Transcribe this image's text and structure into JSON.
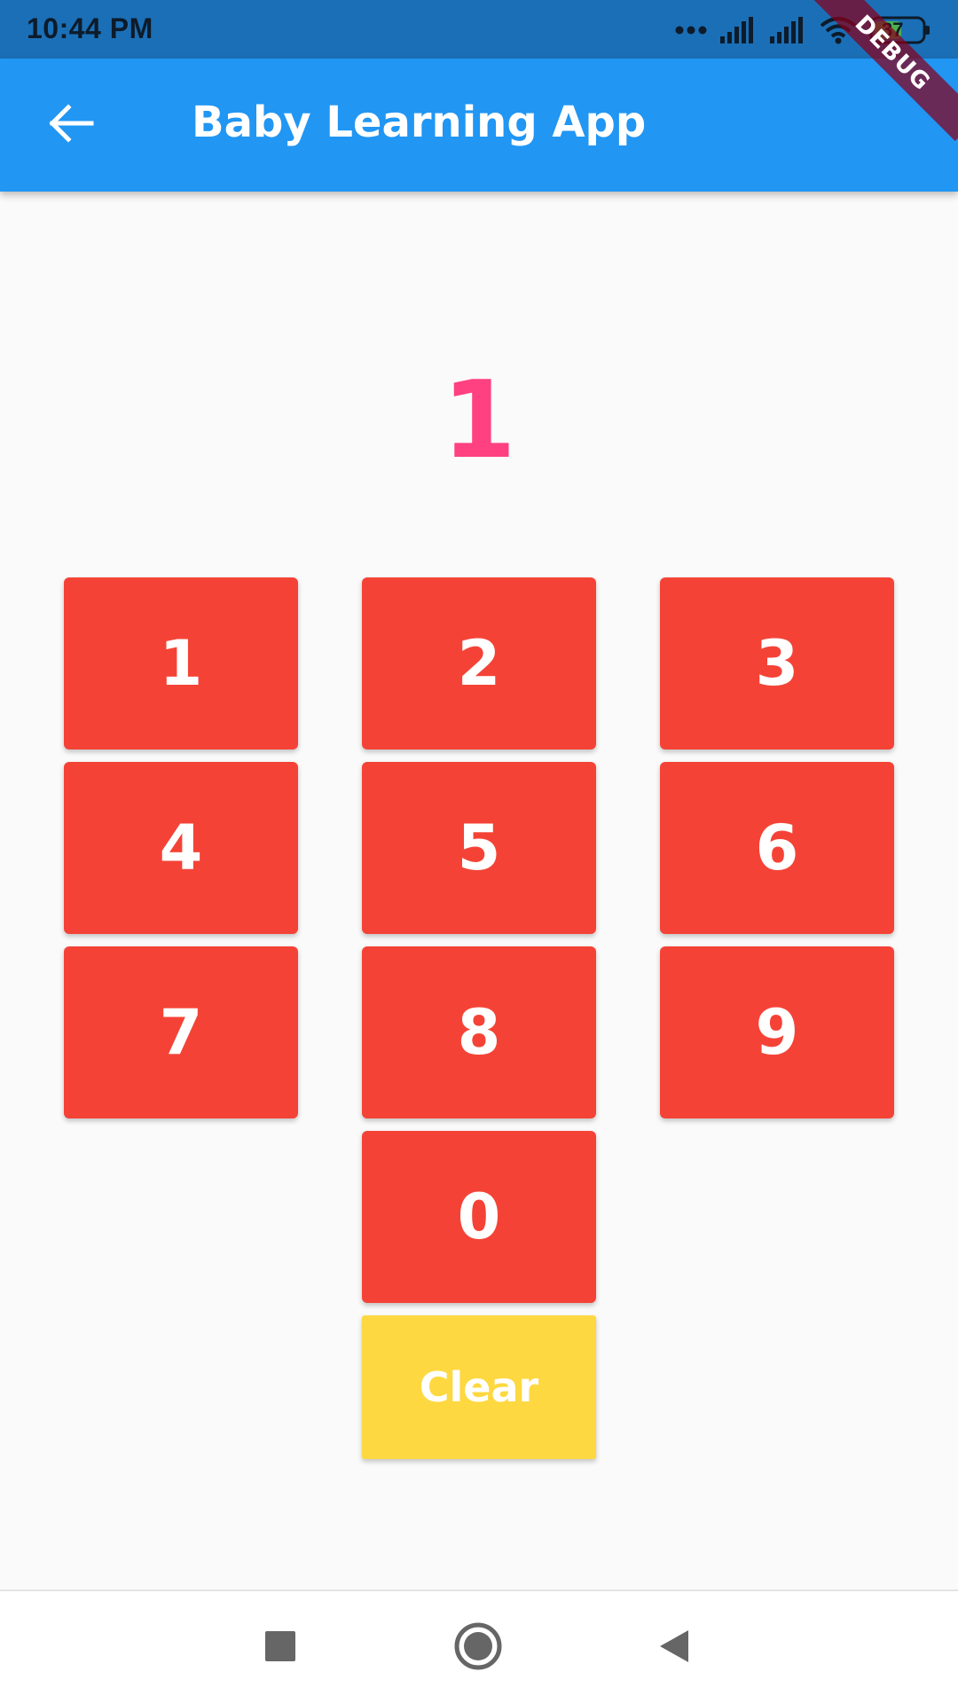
{
  "status_bar": {
    "time": "10:44 PM",
    "battery_level": "37",
    "icons": [
      "dots-icon",
      "signal-icon",
      "signal-icon",
      "wifi-icon",
      "battery-icon"
    ]
  },
  "app_bar": {
    "title": "Baby Learning App",
    "back_icon": "arrow-left-icon",
    "color": "#2196f3"
  },
  "debug_banner": "DEBUG",
  "display": {
    "value": "1",
    "color": "#ff4081"
  },
  "keypad": {
    "key_color": "#f44336",
    "keys": [
      "1",
      "2",
      "3",
      "4",
      "5",
      "6",
      "7",
      "8",
      "9",
      "0"
    ]
  },
  "clear_button": {
    "label": "Clear",
    "color": "#fdd840"
  },
  "nav_bar": {
    "icons": [
      "recents-square-icon",
      "home-circle-icon",
      "back-triangle-icon"
    ]
  }
}
